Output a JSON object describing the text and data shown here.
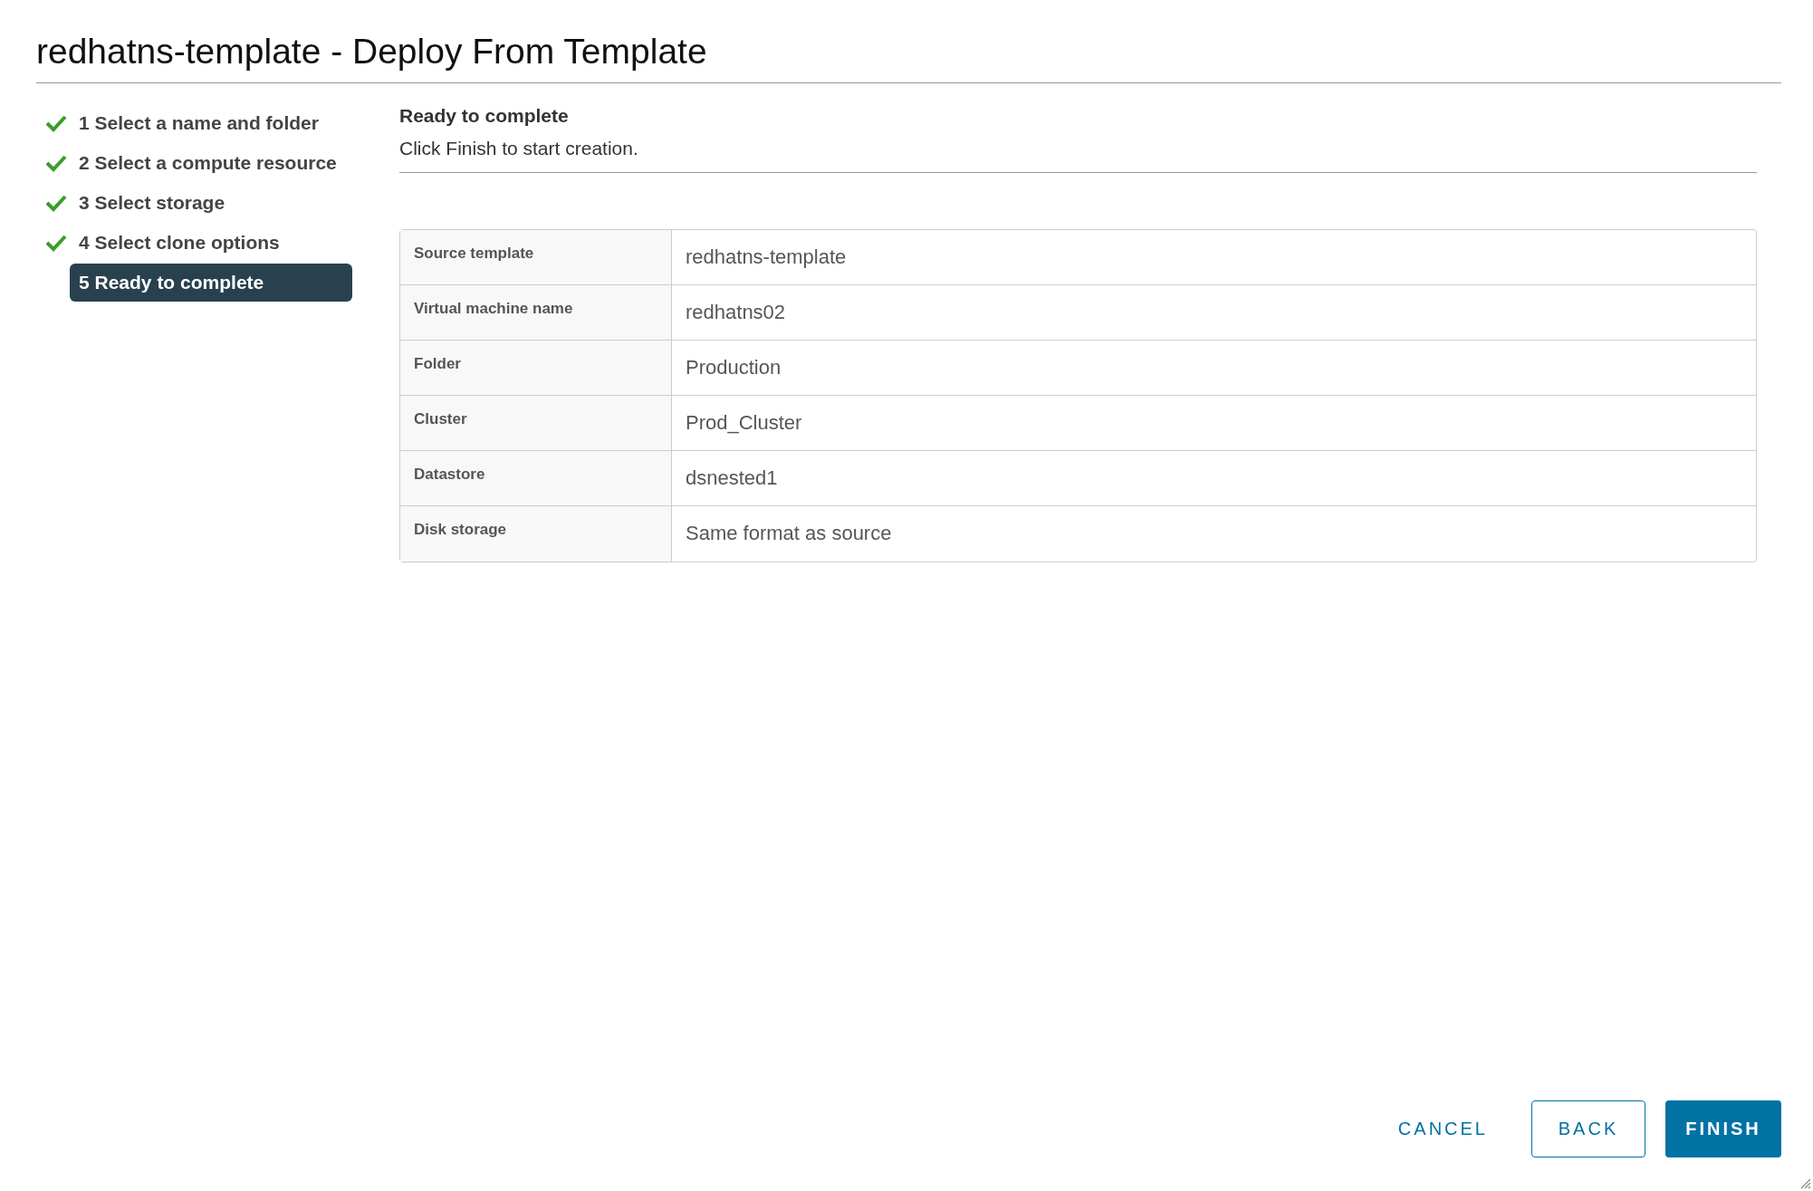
{
  "window": {
    "title": "redhatns-template - Deploy From Template"
  },
  "steps": [
    {
      "label": "1 Select a name and folder",
      "completed": true,
      "selected": false
    },
    {
      "label": "2 Select a compute resource",
      "completed": true,
      "selected": false
    },
    {
      "label": "3 Select storage",
      "completed": true,
      "selected": false
    },
    {
      "label": "4 Select clone options",
      "completed": true,
      "selected": false
    },
    {
      "label": "5 Ready to complete",
      "completed": false,
      "selected": true
    }
  ],
  "page": {
    "heading": "Ready to complete",
    "subtitle": "Click Finish to start creation."
  },
  "summary": [
    {
      "label": "Source template",
      "value": "redhatns-template"
    },
    {
      "label": "Virtual machine name",
      "value": "redhatns02"
    },
    {
      "label": "Folder",
      "value": "Production"
    },
    {
      "label": "Cluster",
      "value": "Prod_Cluster"
    },
    {
      "label": "Datastore",
      "value": "dsnested1"
    },
    {
      "label": "Disk storage",
      "value": "Same format as source"
    }
  ],
  "buttons": [
    {
      "label": "CANCEL",
      "kind": "link"
    },
    {
      "label": "BACK",
      "kind": "outline"
    },
    {
      "label": "FINISH",
      "kind": "primary"
    }
  ]
}
